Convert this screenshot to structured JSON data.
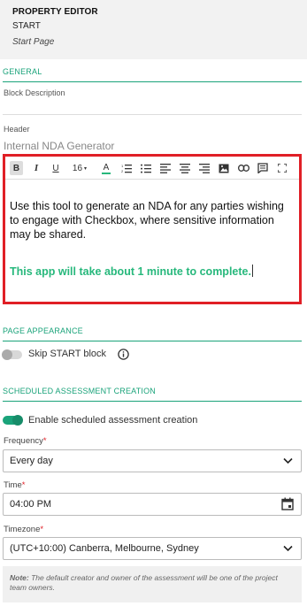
{
  "panel": {
    "title": "PROPERTY EDITOR",
    "name": "START",
    "subtitle": "Start Page"
  },
  "general": {
    "section_label": "GENERAL",
    "block_description_label": "Block Description",
    "header_label": "Header",
    "header_value": "Internal NDA Generator"
  },
  "editor": {
    "toolbar": {
      "bold": "B",
      "italic": "I",
      "underline": "U",
      "font_size": "16",
      "font_color": "A"
    },
    "body_text": "Use this tool to generate an NDA for any parties wishing to engage with Checkbox, where sensitive information may be shared.",
    "highlight_text": "This app will take about 1 minute to complete.",
    "highlight_color": "#27b87c"
  },
  "page_appearance": {
    "section_label": "PAGE APPEARANCE",
    "skip_start_label": "Skip START block",
    "skip_start_enabled": false
  },
  "scheduled": {
    "section_label": "SCHEDULED ASSESSMENT CREATION",
    "enable_label": "Enable scheduled assessment creation",
    "enabled": true,
    "frequency_label": "Frequency",
    "frequency_value": "Every day",
    "time_label": "Time",
    "time_value": "04:00 PM",
    "timezone_label": "Timezone",
    "timezone_value": "(UTC+10:00) Canberra, Melbourne, Sydney",
    "required_marker": "*"
  },
  "note": {
    "prefix": "Note:",
    "text": "The default creator and owner of the assessment will be one of the project team owners."
  },
  "colors": {
    "accent": "#1aa37a",
    "highlight_border": "#e01f26",
    "toggle_on": "#1aa37a"
  }
}
